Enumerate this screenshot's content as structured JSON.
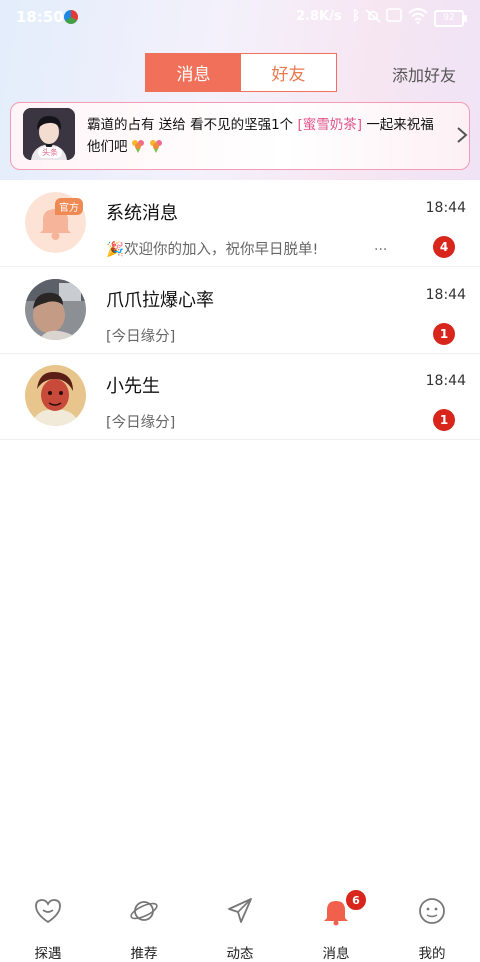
{
  "status_bar": {
    "time": "18:50",
    "net_speed": "2.8K/s",
    "battery": "92"
  },
  "header": {
    "tabs": [
      {
        "label": "消息",
        "active": true
      },
      {
        "label": "好友",
        "active": false
      }
    ],
    "add_friend": "添加好友",
    "accent_color": "#f0705a"
  },
  "gift_banner": {
    "avatar_badge": "头条",
    "text_before": "霸道的占有 送给 看不见的坚强1个",
    "gift": "[蜜雪奶茶]",
    "text_after": "一起来祝福他们吧",
    "highlight_color": "#e0558a"
  },
  "chats": [
    {
      "name": "系统消息",
      "time": "18:44",
      "preview": "欢迎你的加入，祝你早日脱单!",
      "ellipsis": "...",
      "unread": "4",
      "tag": "官方"
    },
    {
      "name": "爪爪拉爆心率",
      "time": "18:44",
      "preview": "[今日缘分]",
      "unread": "1"
    },
    {
      "name": "小先生",
      "time": "18:44",
      "preview": "[今日缘分]",
      "unread": "1"
    }
  ],
  "bottom_nav": [
    {
      "label": "探遇",
      "icon": "heart-icon"
    },
    {
      "label": "推荐",
      "icon": "planet-icon"
    },
    {
      "label": "动态",
      "icon": "send-icon"
    },
    {
      "label": "消息",
      "icon": "bell-icon",
      "badge": "6",
      "active": true
    },
    {
      "label": "我的",
      "icon": "smile-icon"
    }
  ],
  "colors": {
    "badge": "#d8261d",
    "nav_active": "#f0604a"
  }
}
